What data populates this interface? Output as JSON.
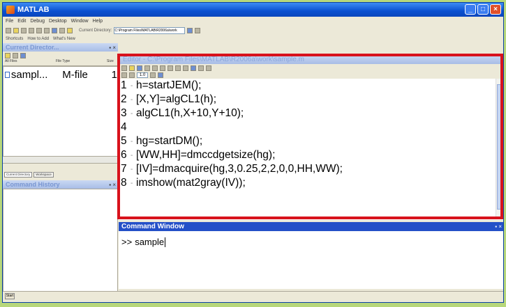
{
  "window": {
    "title": "MATLAB"
  },
  "menu": [
    "File",
    "Edit",
    "Debug",
    "Desktop",
    "Window",
    "Help"
  ],
  "toolbar": {
    "current_directory_label": "Current Directory:",
    "current_directory_value": "C:\\Program Files\\MATLAB\\R2006a\\work"
  },
  "shortcuts": [
    "Shortcuts",
    "How to Add",
    "What's New"
  ],
  "current_directory_panel": {
    "title": "Current Director...",
    "columns": [
      "All Files",
      "File Type",
      "Size"
    ],
    "files": [
      {
        "name": "sampl...",
        "type": "M-file",
        "size": "1"
      }
    ],
    "tabs": [
      "Current Directory",
      "Workspace"
    ]
  },
  "command_history": {
    "title": "Command History"
  },
  "editor": {
    "title": "Editor - C:\\Program Files\\MATLAB\\R2006a\\work\\sample.m",
    "zoom": "1.0",
    "lines": [
      {
        "num": "1",
        "code": "h=startJEM();"
      },
      {
        "num": "2",
        "code": "[X,Y]=algCL1(h);"
      },
      {
        "num": "3",
        "code": "algCL1(h,X+10,Y+10);"
      },
      {
        "num": "4",
        "code": ""
      },
      {
        "num": "5",
        "code": "hg=startDM();"
      },
      {
        "num": "6",
        "code": "[WW,HH]=dmccdgetsize(hg);"
      },
      {
        "num": "7",
        "code": "[IV]=dmacquire(hg,3,0.25,2,2,0,0,HH,WW);"
      },
      {
        "num": "8",
        "code": "imshow(mat2gray(IV));"
      }
    ]
  },
  "command_window": {
    "title": "Command Window",
    "prompt": ">>",
    "input": "sample"
  },
  "status": {
    "start_button": "Start"
  },
  "colors": {
    "highlight_border": "#d8121c",
    "command_header": "#2450c8",
    "outer_frame": "#b7d77b"
  }
}
